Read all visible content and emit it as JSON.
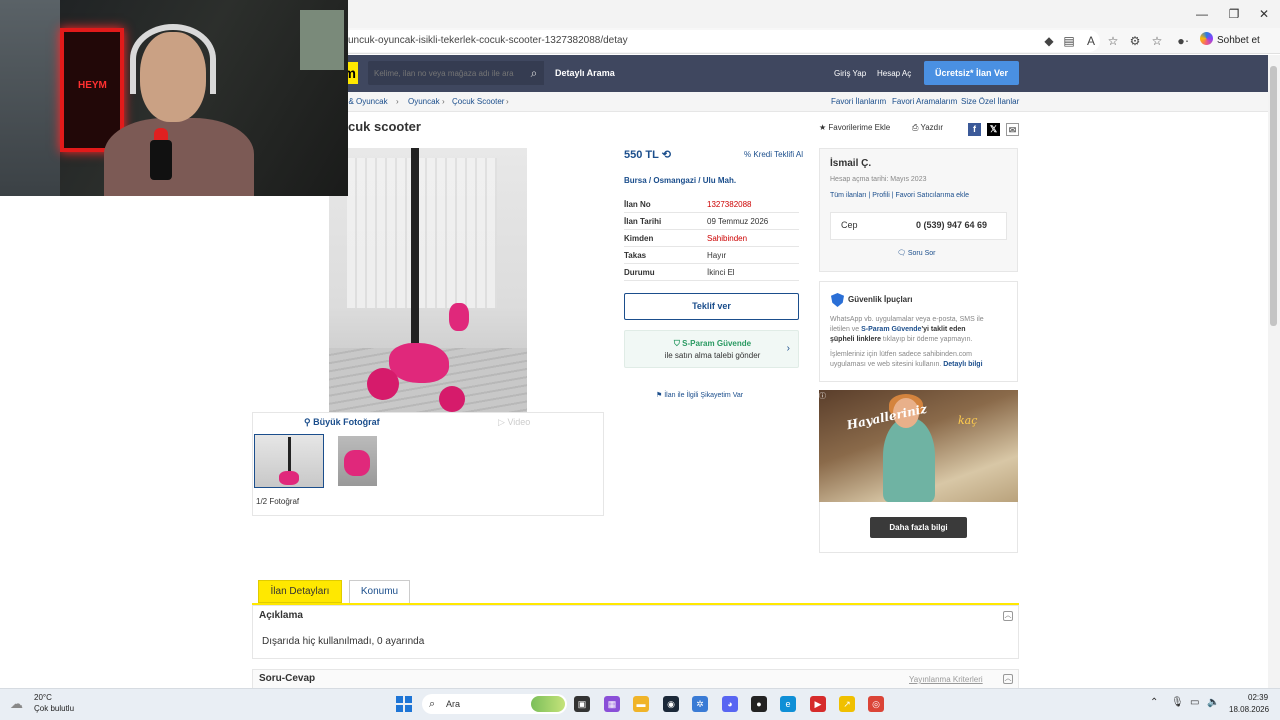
{
  "browser": {
    "url": "uncuk-oyuncak-isikli-tekerlek-cocuk-scooter-1327382088/detay",
    "chat_label": "Sohbet et"
  },
  "site_header": {
    "logo_letter": "m",
    "search_placeholder": "Kelime, ilan no veya mağaza adı ile ara",
    "detailed_search": "Detaylı Arama",
    "login": "Giriş Yap",
    "register": "Hesap Aç",
    "post_ad": "Ücretsiz* İlan Ver"
  },
  "breadcrumb": {
    "items": [
      "bi & Oyuncak",
      "Oyuncak",
      "Çocuk Scooter"
    ],
    "right_links": [
      "Favori İlanlarım",
      "Favori Aramalarım",
      "Size Özel İlanlar"
    ]
  },
  "listing": {
    "title": "cuk scooter",
    "actions": {
      "favorite": "Favorilerime Ekle",
      "print": "Yazdır"
    },
    "price": "550 TL",
    "credit": "Kredi Teklifi Al",
    "location": [
      "Bursa",
      "Osmangazi",
      "Ulu Mah."
    ],
    "details": [
      {
        "key": "İlan No",
        "value": "1327382088",
        "red": true
      },
      {
        "key": "İlan Tarihi",
        "value": "09 Temmuz 2026",
        "red": false
      },
      {
        "key": "Kimden",
        "value": "Sahibinden",
        "red": true
      },
      {
        "key": "Takas",
        "value": "Hayır",
        "red": false
      },
      {
        "key": "Durumu",
        "value": "İkinci El",
        "red": false
      }
    ],
    "offer_button": "Teklif ver",
    "sparam_title": "S-Param Güvende",
    "sparam_sub": "ile satın alma talebi gönder",
    "complaint": "İlan ile İlgili Şikayetim Var"
  },
  "gallery": {
    "big_photo": "Büyük Fotoğraf",
    "video": "Video",
    "counter": "1/2 Fotoğraf"
  },
  "seller": {
    "name": "İsmail Ç.",
    "since": "Hesap açma tarihi: Mayıs 2023",
    "links": "Tüm ilanları | Profili | Favori Satıcılarıma ekle",
    "phone_label": "Cep",
    "phone": "0 (539) 947 64 69",
    "ask": "Soru Sor"
  },
  "security": {
    "title": "Güvenlik İpuçları",
    "p1_a": "WhatsApp vb. uygulamalar veya e-posta, SMS ile",
    "p1_b": "iletilen ve",
    "p1_link": "S-Param Güvende",
    "p1_c": "'yi taklit eden",
    "p1_d": "şüpheli linklere",
    "p1_e": "tıklayıp bir ödeme yapmayın.",
    "p2_a": "İşlemleriniz için lütfen sadece sahibinden.com",
    "p2_b": "uygulaması ve web sitesini kullanın.",
    "p2_link": "Detaylı bilgi"
  },
  "ad": {
    "text1": "Hayalleriniz",
    "text2": "kaç",
    "button": "Daha fazla bilgi"
  },
  "tabs": {
    "details": "İlan Detayları",
    "location": "Konumu"
  },
  "description": {
    "title": "Açıklama",
    "text": "Dışarıda hiç kullanılmadı, 0 ayarında"
  },
  "qa": {
    "title": "Soru-Cevap",
    "criteria": "Yayınlanma Kriterleri"
  },
  "webcam": {
    "neon_text": "HEYM"
  },
  "taskbar": {
    "temp": "20°C",
    "weather": "Çok bulutlu",
    "search": "Ara",
    "time": "02:39",
    "date": "18.08.2026"
  }
}
